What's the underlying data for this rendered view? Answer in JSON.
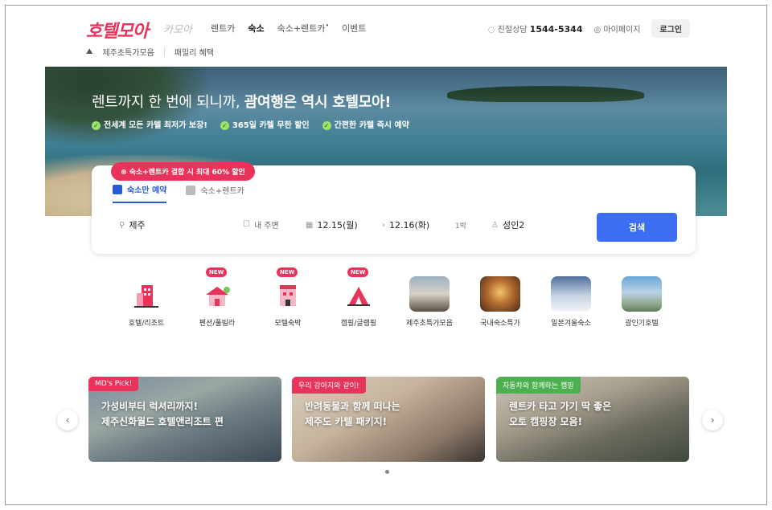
{
  "header": {
    "logo": "호텔모아",
    "logo_sub": "카모아",
    "nav": [
      "렌트카",
      "숙소",
      "숙소+렌트카",
      "이벤트"
    ],
    "nav_active": "숙소",
    "consult_label": "친절상담",
    "phone": "1544-5344",
    "mypage": "마이페이지",
    "login": "로그인"
  },
  "subnav": [
    "제주초특가모음",
    "패밀리 혜택"
  ],
  "hero": {
    "title_plain": "렌트까지 한 번에 되니까,",
    "title_bold": "괌여행은 역시 호텔모아!",
    "features": [
      "전세계 모든 카텔 최저가 보장!",
      "365일 카텔 무한 할인",
      "간편한 카텔 즉시 예약"
    ]
  },
  "search": {
    "promo": "숙소+렌트카 결합 시 최대 60% 할인",
    "tabs": [
      "숙소만 예약",
      "숙소+렌트카"
    ],
    "destination": "제주",
    "nearby": "내 주변",
    "checkin": "12.15(월)",
    "checkout": "12.16(화)",
    "nights": "1박",
    "guests": "성인2",
    "button": "검색"
  },
  "categories": [
    {
      "label": "호텔/리조트",
      "new": "",
      "icon": "hotel-icon"
    },
    {
      "label": "펜션/풀빌라",
      "new": "NEW",
      "icon": "pension-icon"
    },
    {
      "label": "모텔숙박",
      "new": "NEW",
      "icon": "motel-icon"
    },
    {
      "label": "캠핑/글램핑",
      "new": "NEW",
      "icon": "camping-icon"
    },
    {
      "label": "제주초특가모음",
      "new": "",
      "icon": "jeju-photo"
    },
    {
      "label": "국내숙소특가",
      "new": "",
      "icon": "domestic-photo"
    },
    {
      "label": "일본겨울숙소",
      "new": "",
      "icon": "japan-photo"
    },
    {
      "label": "괌인기호텔",
      "new": "",
      "icon": "guam-photo"
    }
  ],
  "banners": [
    {
      "tag": "MD's Pick!",
      "lines": [
        "가성비부터 럭셔리까지!",
        "제주신화월드 호텔앤리조트 편"
      ],
      "tag_color": "#e8335a"
    },
    {
      "tag": "우리 강아지와 같이!",
      "lines": [
        "반려동물과 함께 떠나는",
        "제주도 카텔 패키지!"
      ],
      "tag_color": "#e8335a"
    },
    {
      "tag": "자동차와 함께하는 캠핑",
      "lines": [
        "렌트카 타고 가기 딱 좋은",
        "오토 캠핑장 모음!"
      ],
      "tag_color": "#4caf50"
    }
  ],
  "carousel": {
    "prev": "‹",
    "next": "›"
  }
}
